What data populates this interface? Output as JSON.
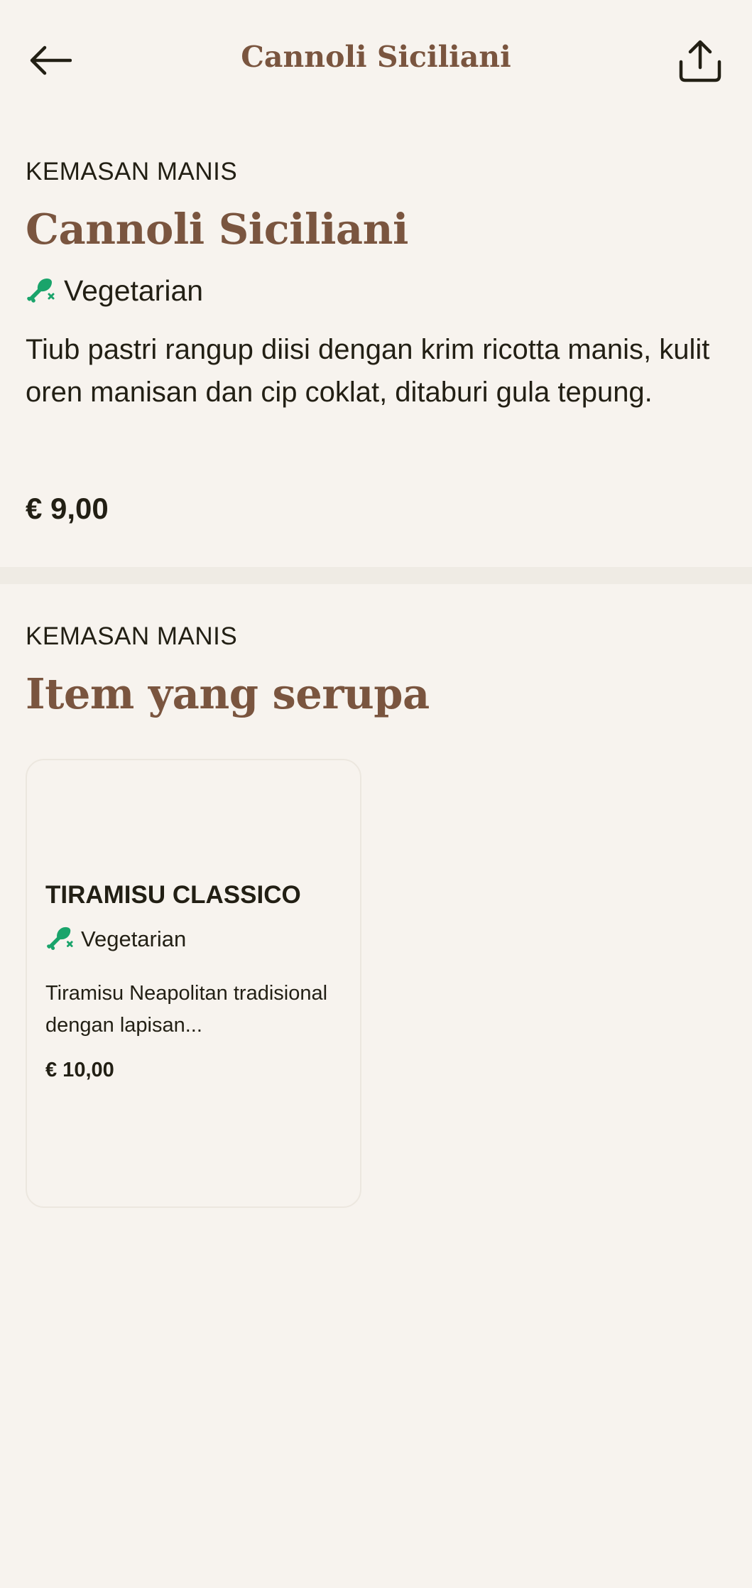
{
  "header": {
    "title": "Cannoli Siciliani",
    "back_icon": "arrow-left-icon",
    "share_icon": "share-icon"
  },
  "product": {
    "category": "KEMASAN MANIS",
    "name": "Cannoli Siciliani",
    "diet_icon": "drumstick-crossed-icon",
    "diet_label": "Vegetarian",
    "description": "Tiub pastri rangup diisi dengan krim ricotta manis, kulit oren manisan dan cip coklat, ditaburi gula tepung.",
    "price": "€ 9,00"
  },
  "similar": {
    "category": "KEMASAN MANIS",
    "heading": "Item yang serupa",
    "items": [
      {
        "name": "TIRAMISU CLASSICO",
        "diet_label": "Vegetarian",
        "description": "Tiramisu Neapolitan tradisional dengan lapisan...",
        "price": "€ 10,00"
      }
    ]
  },
  "colors": {
    "background": "#f7f3ee",
    "accent_brown": "#7a553f",
    "vegetarian_green": "#1aa46b",
    "text": "#221f14"
  }
}
